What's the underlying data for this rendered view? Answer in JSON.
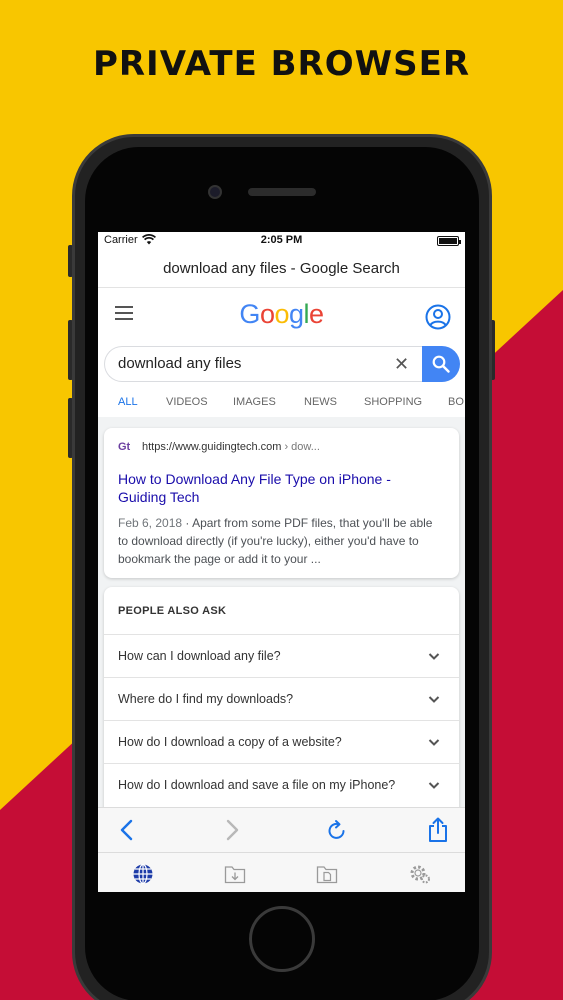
{
  "banner": {
    "headline": "PRIVATE BROWSER"
  },
  "colors": {
    "yellow": "#f8c600",
    "red": "#c50d36",
    "google_blue": "#4285f4",
    "link": "#1a0dab"
  },
  "status_bar": {
    "carrier": "Carrier",
    "time": "2:05 PM"
  },
  "browser": {
    "page_title": "download any files - Google Search"
  },
  "google": {
    "logo_letters": [
      "G",
      "o",
      "o",
      "g",
      "l",
      "e"
    ],
    "search_value": "download any files",
    "tabs": [
      "ALL",
      "VIDEOS",
      "IMAGES",
      "NEWS",
      "SHOPPING",
      "BO"
    ],
    "active_tab": "ALL"
  },
  "result": {
    "favicon": "Gt",
    "url": "https://www.guidingtech.com",
    "url_path": " › dow...",
    "title": "How to Download Any File Type on iPhone - Guiding Tech",
    "date": "Feb 6, 2018",
    "snippet": " · Apart from some PDF files, that you'll be able to download directly (if you're lucky), either you'd have to bookmark the page or add it to your ..."
  },
  "people_also_ask": {
    "title": "PEOPLE ALSO ASK",
    "questions": [
      "How can I download any file?",
      "Where do I find my downloads?",
      "How do I download a copy of a website?",
      "How do I download and save a file on my iPhone?"
    ]
  },
  "toolbar": {
    "icons": [
      "back-icon",
      "forward-icon",
      "reload-icon",
      "share-icon"
    ]
  },
  "tab_bar": {
    "icons": [
      "globe-icon",
      "downloads-folder-icon",
      "files-folder-icon",
      "settings-gear-icon"
    ]
  }
}
